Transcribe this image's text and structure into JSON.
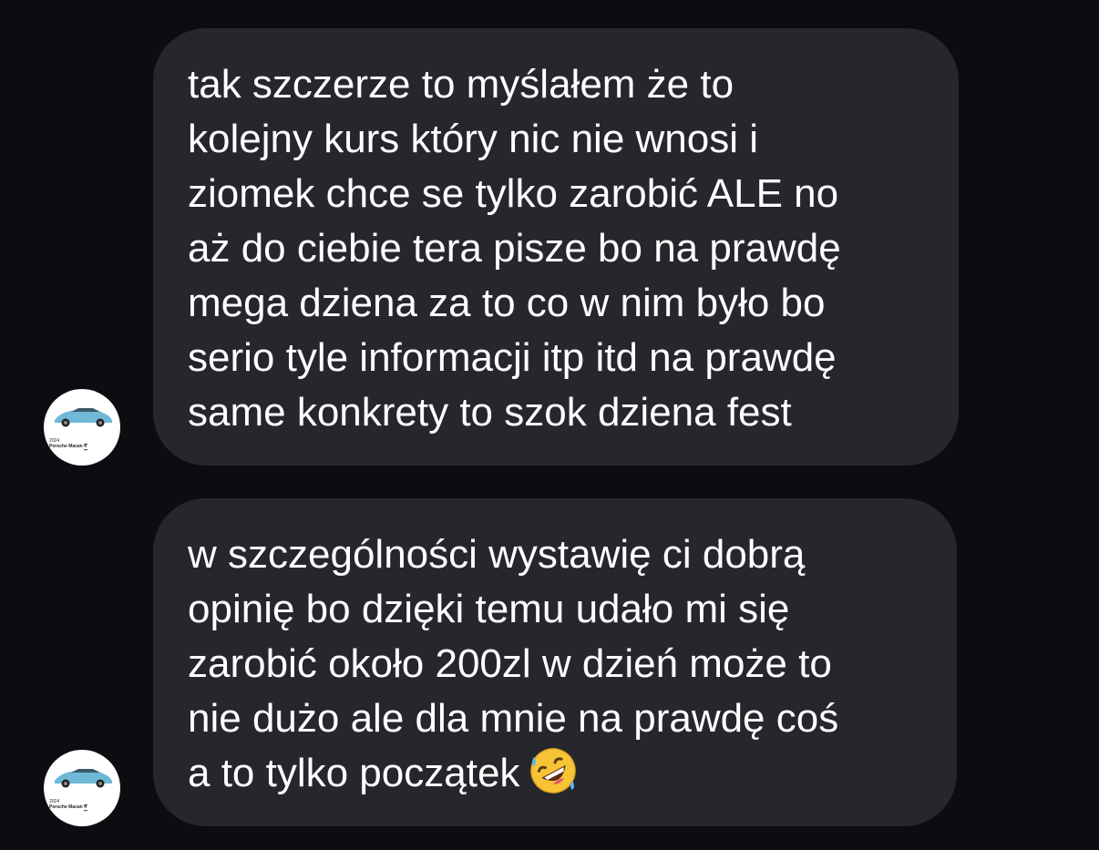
{
  "conversation": {
    "messages": [
      {
        "sender_avatar": {
          "caption_year": "2024",
          "caption_model": "Porsche Macan 4"
        },
        "lines": [
          "tak szczerze to myślałem że to",
          "kolejny kurs który nic nie wnosi i",
          "ziomek chce se tylko zarobić ALE no",
          "aż do ciebie tera pisze bo na prawdę",
          "mega dziena za to co w nim było bo",
          "serio tyle informacji itp itd na prawdę",
          "same konkrety to szok dziena fest"
        ]
      },
      {
        "sender_avatar": {
          "caption_year": "2024",
          "caption_model": "Porsche Macan 4"
        },
        "lines": [
          "w szczególności wystawię ci dobrą",
          "opinię bo dzięki temu udało mi się",
          "zarobić około 200zl w dzień może to",
          "nie dużo ale dla mnie na prawdę coś",
          "a to tylko początek"
        ],
        "trailing_emoji": "rolling-on-the-floor-laughing-emoji"
      }
    ]
  },
  "colors": {
    "background": "#0c0d10",
    "bubble": "#25272c",
    "text": "#ffffff",
    "car": "#6fb8d6"
  }
}
